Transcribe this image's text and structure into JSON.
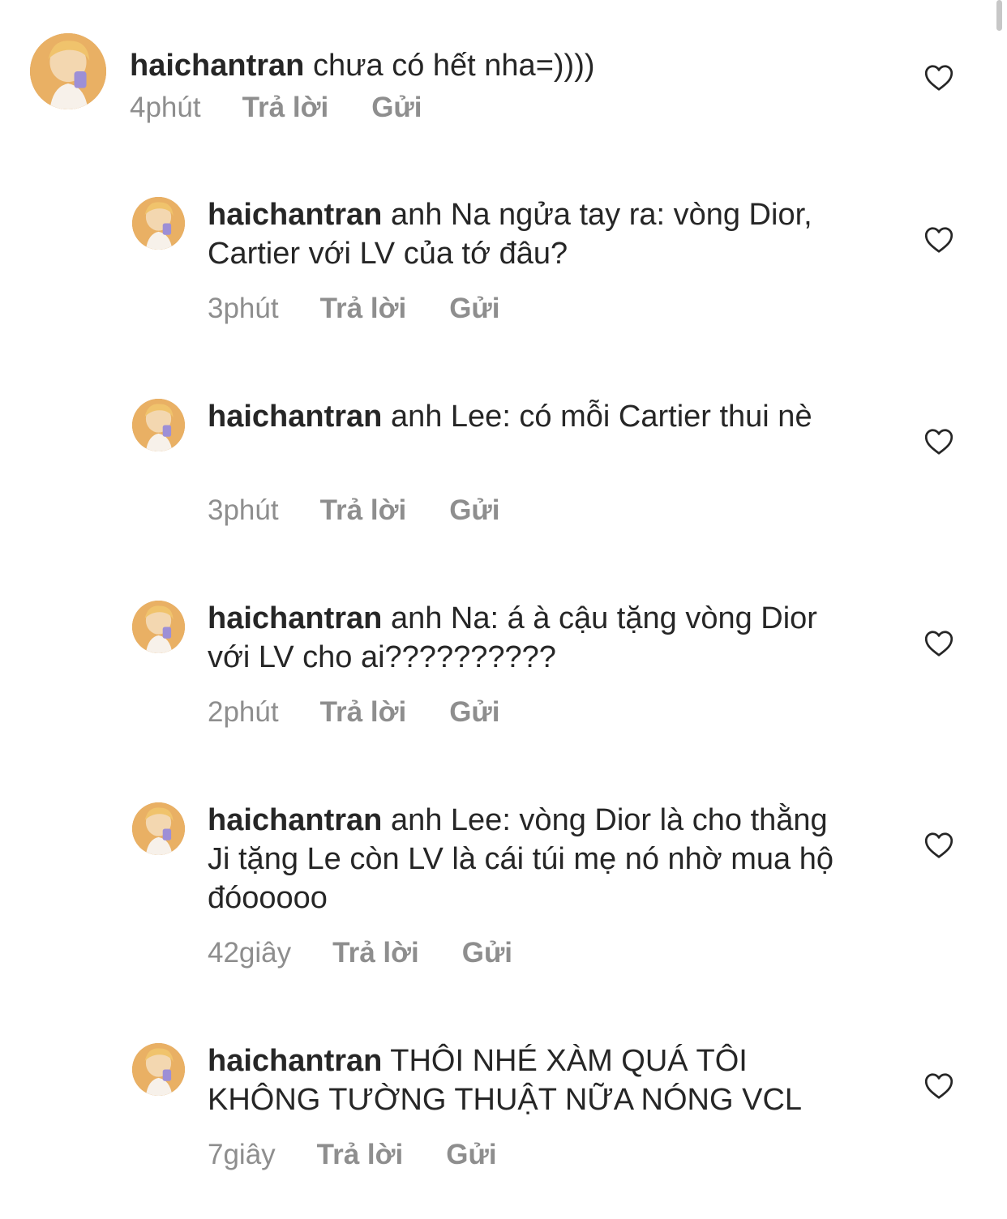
{
  "comments": [
    {
      "username": "haichantran",
      "text": "chưa có hết nha=))))",
      "time": "4phút",
      "reply_label": "Trả lời",
      "send_label": "Gửi"
    },
    {
      "username": "haichantran",
      "text": "anh Na ngửa tay ra: vòng Dior, Cartier với LV của tớ đâu?",
      "time": "3phút",
      "reply_label": "Trả lời",
      "send_label": "Gửi"
    },
    {
      "username": "haichantran",
      "text": "anh Lee: có mỗi Cartier thui nè",
      "time": "3phút",
      "reply_label": "Trả lời",
      "send_label": "Gửi"
    },
    {
      "username": "haichantran",
      "text": "anh Na: á à cậu tặng vòng Dior với LV cho ai??????????",
      "time": "2phút",
      "reply_label": "Trả lời",
      "send_label": "Gửi"
    },
    {
      "username": "haichantran",
      "text": "anh Lee: vòng Dior là cho thằng Ji tặng Le còn LV là cái túi mẹ nó nhờ mua hộ đóooooo",
      "time": "42giây",
      "reply_label": "Trả lời",
      "send_label": "Gửi"
    },
    {
      "username": "haichantran",
      "text": "THÔI NHÉ XÀM QUÁ TÔI KHÔNG TƯỜNG THUẬT NỮA NÓNG VCL",
      "time": "7giây",
      "reply_label": "Trả lời",
      "send_label": "Gửi"
    }
  ],
  "icons": {
    "like": "heart-outline-icon",
    "avatar": "user-avatar"
  },
  "colors": {
    "text": "#262626",
    "secondary": "#8e8e8e",
    "background": "#ffffff"
  }
}
